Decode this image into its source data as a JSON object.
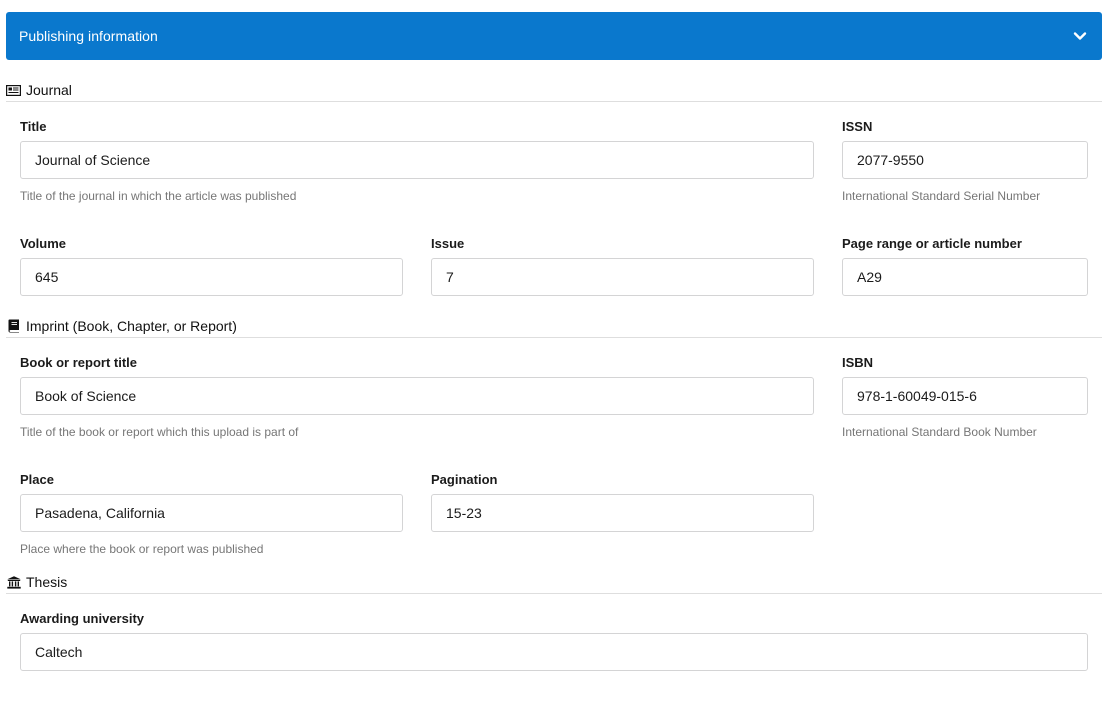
{
  "panel": {
    "title": "Publishing information"
  },
  "journal": {
    "heading": "Journal",
    "title_label": "Title",
    "title_value": "Journal of Science",
    "title_help": "Title of the journal in which the article was published",
    "issn_label": "ISSN",
    "issn_value": "2077-9550",
    "issn_help": "International Standard Serial Number",
    "volume_label": "Volume",
    "volume_value": "645",
    "issue_label": "Issue",
    "issue_value": "7",
    "pages_label": "Page range or article number",
    "pages_value": "A29"
  },
  "imprint": {
    "heading": "Imprint (Book, Chapter, or Report)",
    "title_label": "Book or report title",
    "title_value": "Book of Science",
    "title_help": "Title of the book or report which this upload is part of",
    "isbn_label": "ISBN",
    "isbn_value": "978-1-60049-015-6",
    "isbn_help": "International Standard Book Number",
    "place_label": "Place",
    "place_value": "Pasadena, California",
    "place_help": "Place where the book or report was published",
    "pagination_label": "Pagination",
    "pagination_value": "15-23"
  },
  "thesis": {
    "heading": "Thesis",
    "university_label": "Awarding university",
    "university_value": "Caltech"
  },
  "icons": {
    "panel_toggle": "chevron-down-icon",
    "journal": "newspaper-icon",
    "imprint": "book-icon",
    "thesis": "university-icon"
  },
  "colors": {
    "header_bg": "#0A78CD",
    "header_text": "#FFFFFF",
    "help_text": "#767676",
    "field_border": "#D4D4D5"
  }
}
